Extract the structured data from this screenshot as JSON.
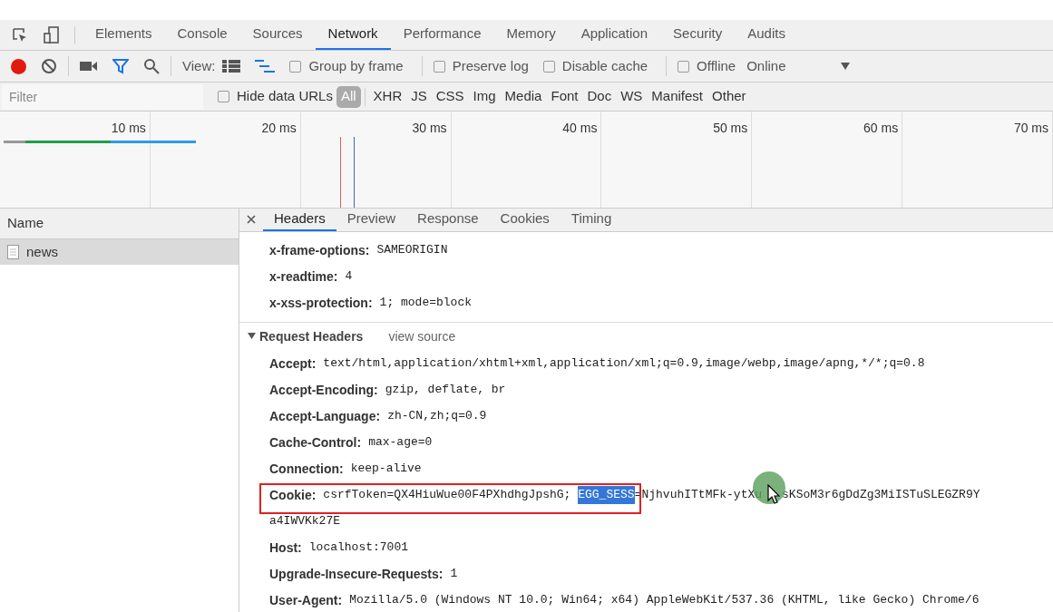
{
  "panel_tabs": [
    {
      "label": "Elements",
      "selected": false
    },
    {
      "label": "Console",
      "selected": false
    },
    {
      "label": "Sources",
      "selected": false
    },
    {
      "label": "Network",
      "selected": true
    },
    {
      "label": "Performance",
      "selected": false
    },
    {
      "label": "Memory",
      "selected": false
    },
    {
      "label": "Application",
      "selected": false
    },
    {
      "label": "Security",
      "selected": false
    },
    {
      "label": "Audits",
      "selected": false
    }
  ],
  "toolbar": {
    "recording": true,
    "filter_on": true,
    "view_label": "View:",
    "large_rows": false,
    "overview": true,
    "options": [
      {
        "label": "Group by frame",
        "checked": false
      },
      {
        "label": "Preserve log",
        "checked": false
      },
      {
        "label": "Disable cache",
        "checked": false
      },
      {
        "label": "Offline",
        "checked": false
      }
    ],
    "throttle": "Online"
  },
  "filter_bar": {
    "placeholder": "Filter",
    "hide_data_urls": {
      "label": "Hide data URLs",
      "checked": false
    },
    "types": [
      {
        "label": "All",
        "selected": true
      },
      {
        "label": "XHR",
        "selected": false
      },
      {
        "label": "JS",
        "selected": false
      },
      {
        "label": "CSS",
        "selected": false
      },
      {
        "label": "Img",
        "selected": false
      },
      {
        "label": "Media",
        "selected": false
      },
      {
        "label": "Font",
        "selected": false
      },
      {
        "label": "Doc",
        "selected": false
      },
      {
        "label": "WS",
        "selected": false
      },
      {
        "label": "Manifest",
        "selected": false
      },
      {
        "label": "Other",
        "selected": false
      }
    ]
  },
  "timeline": {
    "ticks": [
      "10 ms",
      "20 ms",
      "30 ms",
      "40 ms",
      "50 ms",
      "60 ms",
      "70 ms"
    ]
  },
  "requests": {
    "column": "Name",
    "rows": [
      {
        "name": "news",
        "selected": true
      }
    ]
  },
  "detail_tabs": [
    {
      "label": "Headers",
      "selected": true
    },
    {
      "label": "Preview",
      "selected": false
    },
    {
      "label": "Response",
      "selected": false
    },
    {
      "label": "Cookies",
      "selected": false
    },
    {
      "label": "Timing",
      "selected": false
    }
  ],
  "response_headers": [
    {
      "name": "x-frame-options:",
      "value": "SAMEORIGIN"
    },
    {
      "name": "x-readtime:",
      "value": "4"
    },
    {
      "name": "x-xss-protection:",
      "value": "1; mode=block"
    }
  ],
  "request_headers": {
    "title": "Request Headers",
    "expanded": true,
    "view_source": "view source",
    "items": [
      {
        "kind": "plain",
        "name": "Accept:",
        "value": "text/html,application/xhtml+xml,application/xml;q=0.9,image/webp,image/apng,*/*;q=0.8"
      },
      {
        "kind": "plain",
        "name": "Accept-Encoding:",
        "value": "gzip, deflate, br"
      },
      {
        "kind": "plain",
        "name": "Accept-Language:",
        "value": "zh-CN,zh;q=0.9"
      },
      {
        "kind": "plain",
        "name": "Cache-Control:",
        "value": "max-age=0"
      },
      {
        "kind": "plain",
        "name": "Connection:",
        "value": "keep-alive"
      },
      {
        "kind": "cookie",
        "name": "Cookie:",
        "value": "csrfToken=QX4HiuWue00F4PXhdhgJpshG; ",
        "selection": "EGG_SESS",
        "rest": "=NjhvuhITtMFk-ytXu",
        "rest_after_cursor": "sKSoM3r6gDdZg3MiISTuSLEGZR9Y",
        "continuation": "a4IWVKk27E"
      },
      {
        "kind": "plain",
        "name": "Host:",
        "value": "localhost:7001"
      },
      {
        "kind": "plain",
        "name": "Upgrade-Insecure-Requests:",
        "value": "1"
      },
      {
        "kind": "plain",
        "name": "User-Agent:",
        "value": "Mozilla/5.0 (Windows NT 10.0; Win64; x64) AppleWebKit/537.36 (KHTML, like Gecko) Chrome/6"
      }
    ]
  }
}
